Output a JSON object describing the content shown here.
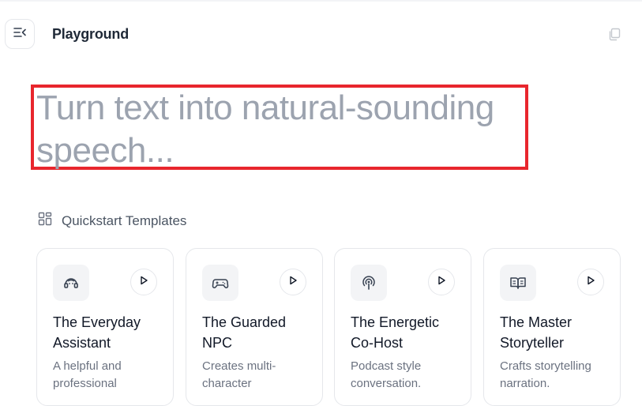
{
  "header": {
    "title": "Playground",
    "menu_icon": "sidebar-toggle-icon",
    "copy_icon": "copy-icon"
  },
  "prompt": {
    "placeholder": "Turn text into natural-sounding speech..."
  },
  "quickstart": {
    "icon": "grid-icon",
    "title": "Quickstart Templates",
    "cards": [
      {
        "icon": "assistant-icon",
        "title": "The Everyday Assistant",
        "description": "A helpful and professional"
      },
      {
        "icon": "gamepad-icon",
        "title": "The Guarded NPC",
        "description": "Creates multi-character"
      },
      {
        "icon": "podcast-icon",
        "title": "The Energetic Co-Host",
        "description": "Podcast style conversation."
      },
      {
        "icon": "book-icon",
        "title": "The Master Storyteller",
        "description": "Crafts storytelling narration."
      }
    ]
  },
  "colors": {
    "highlight_border": "#e8262d",
    "placeholder_text": "#9ca3af"
  }
}
